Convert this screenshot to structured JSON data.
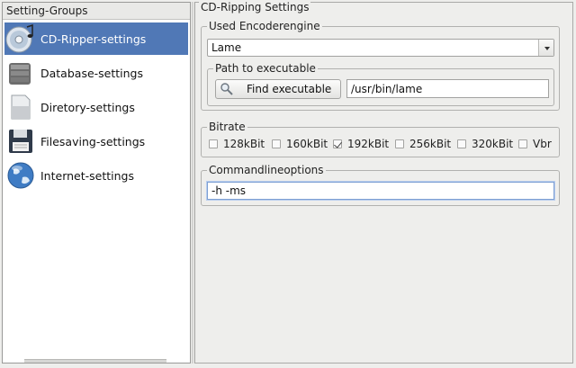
{
  "setting_groups": {
    "header": "Setting-Groups",
    "items": [
      {
        "label": "CD-Ripper-settings",
        "icon": "cd-icon",
        "selected": true
      },
      {
        "label": "Database-settings",
        "icon": "database-icon",
        "selected": false
      },
      {
        "label": "Diretory-settings",
        "icon": "directory-icon",
        "selected": false
      },
      {
        "label": "Filesaving-settings",
        "icon": "floppy-disk-icon",
        "selected": false
      },
      {
        "label": "Internet-settings",
        "icon": "globe-icon",
        "selected": false
      }
    ]
  },
  "cd_ripping": {
    "title": "CD-Ripping Settings",
    "encoder_group": {
      "title": "Used Encoderengine",
      "selected": "Lame",
      "path_group": {
        "title": "Path to executable",
        "find_button": "Find executable",
        "path_value": "/usr/bin/lame"
      }
    },
    "bitrate": {
      "title": "Bitrate",
      "options": [
        {
          "label": "128kBit",
          "checked": false
        },
        {
          "label": "160kBit",
          "checked": false
        },
        {
          "label": "192kBit",
          "checked": true
        },
        {
          "label": "256kBit",
          "checked": false
        },
        {
          "label": "320kBit",
          "checked": false
        },
        {
          "label": "Vbr",
          "checked": false
        }
      ]
    },
    "commandline": {
      "title": "Commandlineoptions",
      "value": "-h -ms"
    }
  },
  "colors": {
    "selection": "#5078b6",
    "window_bg": "#eeeeec"
  }
}
